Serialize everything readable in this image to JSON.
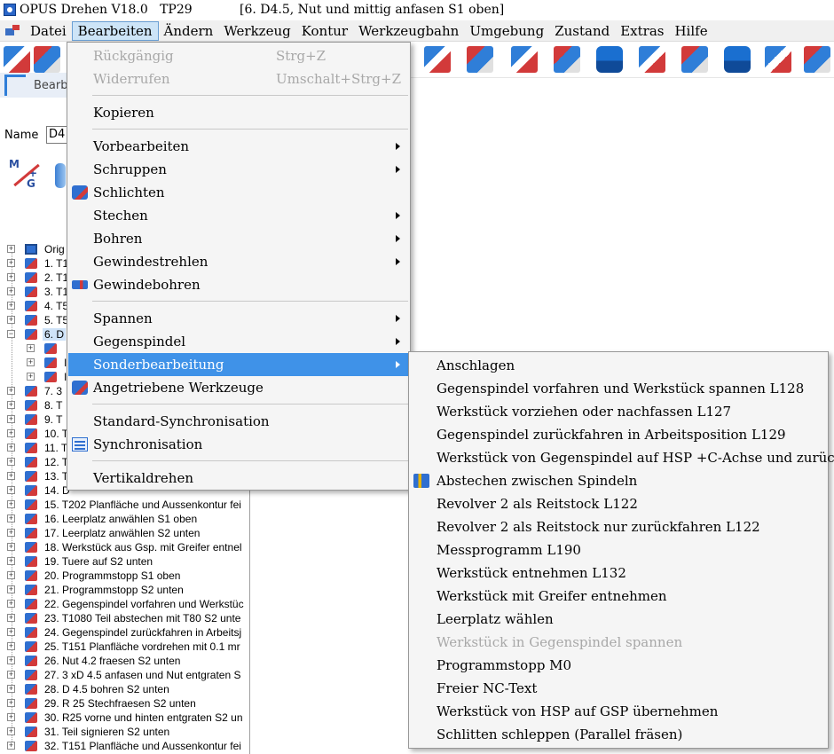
{
  "window": {
    "title": "OPUS Drehen V18.0   TP29",
    "subtitle": "[6. D4.5, Nut und mittig anfasen S1 oben]"
  },
  "menubar": {
    "items": [
      "Datei",
      "Bearbeiten",
      "Ändern",
      "Werkzeug",
      "Kontur",
      "Werkzeugbahn",
      "Umgebung",
      "Zustand",
      "Extras",
      "Hilfe"
    ],
    "active": "Bearbeiten"
  },
  "toolbar2": {
    "label": "Bearb"
  },
  "name_row": {
    "label": "Name",
    "value": "D4"
  },
  "mg_icon": {
    "m": "M",
    "plus": "+",
    "g": "G"
  },
  "tree": {
    "rows": [
      {
        "text": "Orig",
        "expander": "+",
        "indent": 0
      },
      {
        "text": "1. T1",
        "expander": "+",
        "indent": 0
      },
      {
        "text": "2. T1",
        "expander": "+",
        "indent": 0
      },
      {
        "text": "3. T1",
        "expander": "+",
        "indent": 0
      },
      {
        "text": "4. T5",
        "expander": "+",
        "indent": 0
      },
      {
        "text": "5. T5",
        "expander": "+",
        "indent": 0
      },
      {
        "text": "6. D",
        "expander": "−",
        "indent": 0,
        "selected": true
      },
      {
        "text": "",
        "expander": "+",
        "indent": 1
      },
      {
        "text": "I",
        "expander": "+",
        "indent": 1
      },
      {
        "text": "I",
        "expander": "+",
        "indent": 1
      },
      {
        "text": "7. 3",
        "expander": "+",
        "indent": 0
      },
      {
        "text": "8. T",
        "expander": "+",
        "indent": 0
      },
      {
        "text": "9. T",
        "expander": "+",
        "indent": 0
      },
      {
        "text": "10. T",
        "expander": "+",
        "indent": 0
      },
      {
        "text": "11. T",
        "expander": "+",
        "indent": 0
      },
      {
        "text": "12. T",
        "expander": "+",
        "indent": 0
      },
      {
        "text": "13. T",
        "expander": "+",
        "indent": 0
      },
      {
        "text": "14. D",
        "expander": "+",
        "indent": 0
      },
      {
        "text": "15. T202 Planfläche und Aussenkontur fei",
        "expander": "+",
        "indent": 0
      },
      {
        "text": "16. Leerplatz anwählen S1 oben",
        "expander": "+",
        "indent": 0
      },
      {
        "text": "17. Leerplatz anwählen S2 unten",
        "expander": "+",
        "indent": 0
      },
      {
        "text": "18. Werkstück aus Gsp. mit Greifer entnel",
        "expander": "+",
        "indent": 0
      },
      {
        "text": "19. Tuere auf S2 unten",
        "expander": "+",
        "indent": 0
      },
      {
        "text": "20. Programmstopp S1 oben",
        "expander": "+",
        "indent": 0
      },
      {
        "text": "21. Programmstopp S2 unten",
        "expander": "+",
        "indent": 0
      },
      {
        "text": "22. Gegenspindel vorfahren und Werkstüc",
        "expander": "+",
        "indent": 0
      },
      {
        "text": "23. T1080 Teil abstechen mit T80 S2 unte",
        "expander": "+",
        "indent": 0
      },
      {
        "text": "24. Gegenspindel zurückfahren in Arbeitsj",
        "expander": "+",
        "indent": 0
      },
      {
        "text": "25. T151 Planfläche vordrehen mit 0.1 mr",
        "expander": "+",
        "indent": 0
      },
      {
        "text": "26. Nut 4.2 fraesen S2 unten",
        "expander": "+",
        "indent": 0
      },
      {
        "text": "27. 3 xD 4.5 anfasen und Nut entgraten S",
        "expander": "+",
        "indent": 0
      },
      {
        "text": "28. D 4.5 bohren S2 unten",
        "expander": "+",
        "indent": 0
      },
      {
        "text": "29. R 25 Stechfraesen S2 unten",
        "expander": "+",
        "indent": 0
      },
      {
        "text": "30. R25 vorne und hinten entgraten S2 un",
        "expander": "+",
        "indent": 0
      },
      {
        "text": "31. Teil signieren S2 unten",
        "expander": "+",
        "indent": 0
      },
      {
        "text": "32. T151 Planfläche und Aussenkontur fei",
        "expander": "+",
        "indent": 0
      }
    ]
  },
  "edit_menu": {
    "items": [
      {
        "label": "Rückgängig",
        "shortcut": "Strg+Z",
        "disabled": true
      },
      {
        "label": "Widerrufen",
        "shortcut": "Umschalt+Strg+Z",
        "disabled": true
      },
      {
        "separator": true
      },
      {
        "label": "Kopieren"
      },
      {
        "separator": true
      },
      {
        "label": "Vorbearbeiten",
        "submenu": true
      },
      {
        "label": "Schruppen",
        "submenu": true
      },
      {
        "label": "Schlichten",
        "icon": "finishing-tool-icon"
      },
      {
        "label": "Stechen",
        "submenu": true
      },
      {
        "label": "Bohren",
        "submenu": true
      },
      {
        "label": "Gewindestrehlen",
        "submenu": true
      },
      {
        "label": "Gewindebohren",
        "icon": "tapping-tool-icon"
      },
      {
        "separator": true
      },
      {
        "label": "Spannen",
        "submenu": true
      },
      {
        "label": "Gegenspindel",
        "submenu": true
      },
      {
        "label": "Sonderbearbeitung",
        "submenu": true,
        "highlight": true
      },
      {
        "label": "Angetriebene Werkzeuge",
        "icon": "driven-tool-icon"
      },
      {
        "separator": true
      },
      {
        "label": "Standard-Synchronisation"
      },
      {
        "label": "Synchronisation",
        "icon": "synchronisation-icon"
      },
      {
        "separator": true
      },
      {
        "label": "Vertikaldrehen"
      }
    ]
  },
  "special_menu": {
    "items": [
      {
        "label": "Anschlagen"
      },
      {
        "label": "Gegenspindel vorfahren und Werkstück spannen L128"
      },
      {
        "label": "Werkstück vorziehen oder nachfassen L127"
      },
      {
        "label": "Gegenspindel zurückfahren in Arbeitsposition L129"
      },
      {
        "label": "Werkstück von Gegenspindel auf HSP +C-Achse und zurück"
      },
      {
        "label": "Abstechen zwischen Spindeln",
        "icon": "cutoff-spindles-icon"
      },
      {
        "label": "Revolver 2 als Reitstock L122"
      },
      {
        "label": "Revolver 2 als Reitstock nur zurückfahren L122"
      },
      {
        "label": "Messprogramm L190"
      },
      {
        "label": "Werkstück entnehmen L132"
      },
      {
        "label": "Werkstück mit Greifer entnehmen"
      },
      {
        "label": "Leerplatz wählen"
      },
      {
        "label": "Werkstück in Gegenspindel spannen",
        "disabled": true
      },
      {
        "label": "Programmstopp M0"
      },
      {
        "label": "Freier NC-Text"
      },
      {
        "label": "Werkstück von HSP auf GSP übernehmen"
      },
      {
        "label": "Schlitten schleppen (Parallel fräsen)"
      }
    ]
  },
  "colors": {
    "highlight": "#3f92e8",
    "menu_bg": "#f5f5f5",
    "disabled_text": "#a8a8a8",
    "accent_blue": "#2f6fd0",
    "accent_red": "#d23a3a"
  }
}
